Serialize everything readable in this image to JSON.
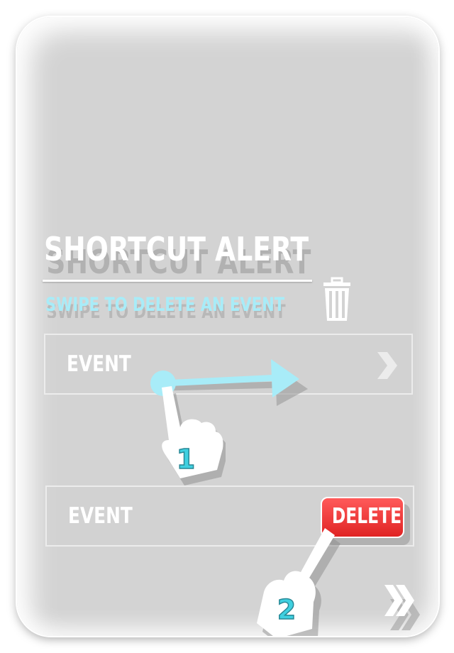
{
  "tutorial": {
    "title": "SHORTCUT ALERT",
    "subtitle": "SWIPE TO DELETE AN EVENT"
  },
  "rows": [
    {
      "label": "EVENT",
      "trailing_icon": "chevron-right-icon"
    },
    {
      "label": "EVENT",
      "action_label": "DELETE"
    }
  ],
  "steps": [
    {
      "number": "1",
      "gesture": "swipe-right"
    },
    {
      "number": "2",
      "gesture": "tap-delete"
    }
  ],
  "icons": {
    "trash": "trash-icon",
    "next": "double-chevron-right-icon"
  },
  "colors": {
    "overlay": "#d3d3d3",
    "accent": "#a8ecf8",
    "delete": "#e02424",
    "step_number": "#3fd0e0"
  }
}
